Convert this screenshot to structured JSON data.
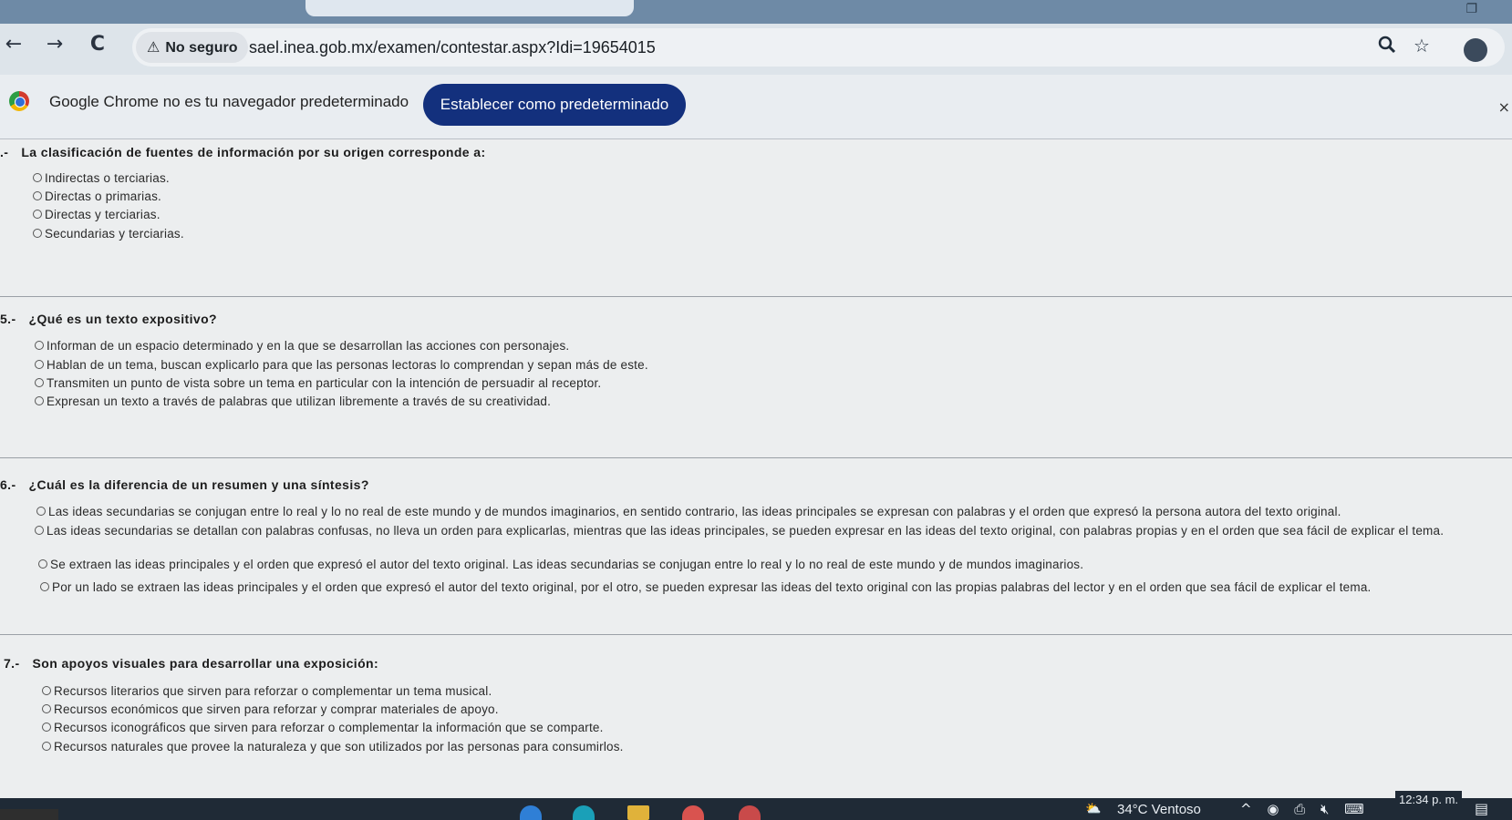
{
  "browser": {
    "window_controls": {
      "restore": "❐"
    },
    "nav": {
      "back": "←",
      "forward": "→",
      "reload": "C"
    },
    "security_chip": {
      "icon": "⚠",
      "label": "No seguro"
    },
    "url": "sael.inea.gob.mx/examen/contestar.aspx?Idi=19654015",
    "omnibox_icons": {
      "zoom": "zoom-icon",
      "bookmark": "star-icon"
    }
  },
  "infobar": {
    "message": "Google Chrome no es tu navegador predeterminado",
    "button_label": "Establecer como predeterminado",
    "close": "×"
  },
  "questions": [
    {
      "number": ".-",
      "text": "La clasificación de fuentes de información por su origen corresponde a:",
      "options": [
        "Indirectas o terciarias.",
        "Directas o primarias.",
        "Directas y terciarias.",
        "Secundarias y terciarias."
      ]
    },
    {
      "number": "5.-",
      "text": "¿Qué es un texto expositivo?",
      "options": [
        "Informan de un espacio determinado y en la que se desarrollan las acciones con personajes.",
        "Hablan de un tema, buscan explicarlo para que las personas lectoras lo comprendan y sepan más de este.",
        "Transmiten un punto de vista sobre un tema en particular con la intención de persuadir al receptor.",
        "Expresan un texto a través de palabras que utilizan libremente a través de su creatividad."
      ]
    },
    {
      "number": "6.-",
      "text": "¿Cuál es la diferencia de un resumen y una síntesis?",
      "options": [
        "Las ideas secundarias se conjugan entre lo real y lo no real de este mundo y de mundos imaginarios, en sentido contrario, las ideas principales se expresan con palabras y el orden que expresó la persona autora del texto original.",
        "Las ideas secundarias se detallan con palabras confusas, no lleva un orden para explicarlas, mientras que las ideas principales, se pueden expresar en las ideas del texto original, con palabras propias y en el orden que sea fácil de explicar el tema.",
        "Se extraen las ideas principales y el orden que expresó el autor del texto original. Las ideas secundarias se conjugan entre lo real y lo no real de este mundo y de mundos imaginarios.",
        "Por un lado se extraen las ideas principales y el orden que expresó el autor del texto original, por el otro, se pueden expresar las ideas del texto original con las propias palabras del lector y en el orden que sea fácil de explicar el tema."
      ]
    },
    {
      "number": "7.-",
      "text": "Son apoyos visuales para desarrollar una exposición:",
      "options": [
        "Recursos literarios que sirven para reforzar o complementar un tema musical.",
        "Recursos económicos que sirven para reforzar y comprar materiales de apoyo.",
        "Recursos iconográficos que sirven para reforzar o complementar la información que se comparte.",
        "Recursos naturales que provee la naturaleza y que son utilizados por las personas para consumirlos."
      ]
    }
  ],
  "taskbar": {
    "weather": "34°C  Ventoso",
    "weather_icon": "⛅",
    "tray_icons": "^ ◉ ⎙ 🔇︎ ⌨",
    "clock": "12:34 p. m.",
    "notification_icon": "▤"
  }
}
